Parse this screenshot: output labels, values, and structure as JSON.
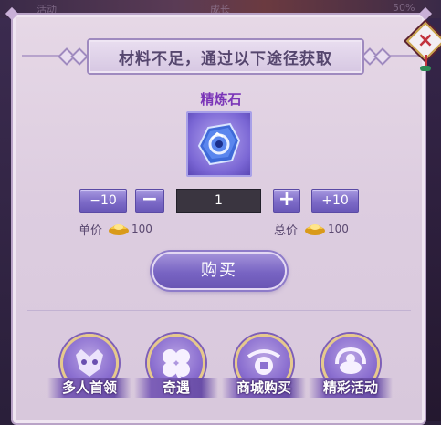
{
  "background": {
    "top_texts": [
      "活动",
      "成长",
      "50%"
    ]
  },
  "dialog": {
    "title": "材料不足，通过以下途径获取",
    "close_icon": "close-x-icon",
    "accent_color": "#7b35b8"
  },
  "item": {
    "name": "精炼石",
    "icon": "blue-refining-stone-icon"
  },
  "quantity": {
    "minus10_label": "−10",
    "minus_label": "−",
    "value": "1",
    "plus_label": "+",
    "plus10_label": "+10"
  },
  "price": {
    "unit_label": "单价",
    "unit_value": "100",
    "total_label": "总价",
    "total_value": "100",
    "currency_icon": "gold-ingot-icon"
  },
  "buy_button": {
    "label": "购买"
  },
  "sources": [
    {
      "label": "多人首领",
      "icon": "dragon-mask-icon"
    },
    {
      "label": "奇遇",
      "icon": "four-leaf-clover-icon"
    },
    {
      "label": "商城购买",
      "icon": "shop-coin-icon"
    },
    {
      "label": "精彩活动",
      "icon": "gift-activity-icon"
    }
  ]
}
